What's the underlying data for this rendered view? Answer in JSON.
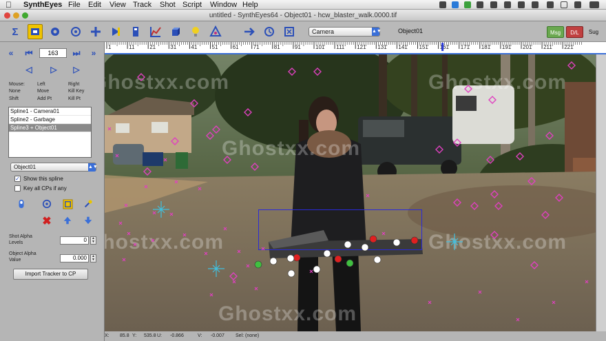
{
  "menubar": {
    "apple": "",
    "app_name": "SynthEyes",
    "items": [
      "File",
      "Edit",
      "View",
      "Track",
      "Shot",
      "Script",
      "Window",
      "Help"
    ],
    "ghost_label": "Ghostxx.com"
  },
  "window": {
    "title": "untitled - SynthEyes64 - Object01 - hcw_blaster_walk.0000.tif"
  },
  "toolbar": {
    "camera_select": "Camera",
    "object_label": "Object01",
    "msg_button": "Msg",
    "dl_button": "D/L",
    "sug_button": "Sug"
  },
  "left_panel": {
    "frame_number": "163",
    "mouse_legend": {
      "header": [
        "Mouse:",
        "Left",
        "Right"
      ],
      "row1": [
        "None",
        "Move",
        "Kill Key"
      ],
      "row2": [
        "Shift",
        "Add Pt",
        "Kill Pt"
      ]
    },
    "splines": [
      "Spline1 - Camera01",
      "Spline2 - Garbage",
      "Spline3 + Object01"
    ],
    "selected_spline_index": 2,
    "object_select": "Object01",
    "show_spline_label": "Show this spline",
    "show_spline_checked": true,
    "key_all_label": "Key all CPs if any",
    "key_all_checked": false,
    "shot_alpha_label": "Shot Alpha\nLevels",
    "shot_alpha_value": "0",
    "object_alpha_label": "Object Alpha\nValue",
    "object_alpha_value": "0.000",
    "import_button": "Import Tracker to CP"
  },
  "timeline": {
    "ticks": [
      "1",
      "11",
      "21",
      "31",
      "41",
      "51",
      "61",
      "71",
      "81",
      "91",
      "101",
      "111",
      "121",
      "131",
      "141",
      "151",
      "161",
      "171",
      "181",
      "191",
      "201",
      "211",
      "221"
    ],
    "current_frame": 163
  },
  "statusbar": {
    "x_label": "X:",
    "x_value": "85.8",
    "y_label": "Y:",
    "y_value": "535.8",
    "u_label": "U:",
    "u_value": "-0.866",
    "v_label": "V:",
    "v_value": "-0.007",
    "sel_label": "Sel: (none)"
  },
  "watermark": "Ghostxx.com",
  "colors": {
    "accent_blue": "#2b4fb8",
    "active_yellow": "#f0c400",
    "tracker_magenta": "#e040c0",
    "tracker_cyan": "#40c0e0",
    "roi_blue": "#2a2ad8"
  }
}
